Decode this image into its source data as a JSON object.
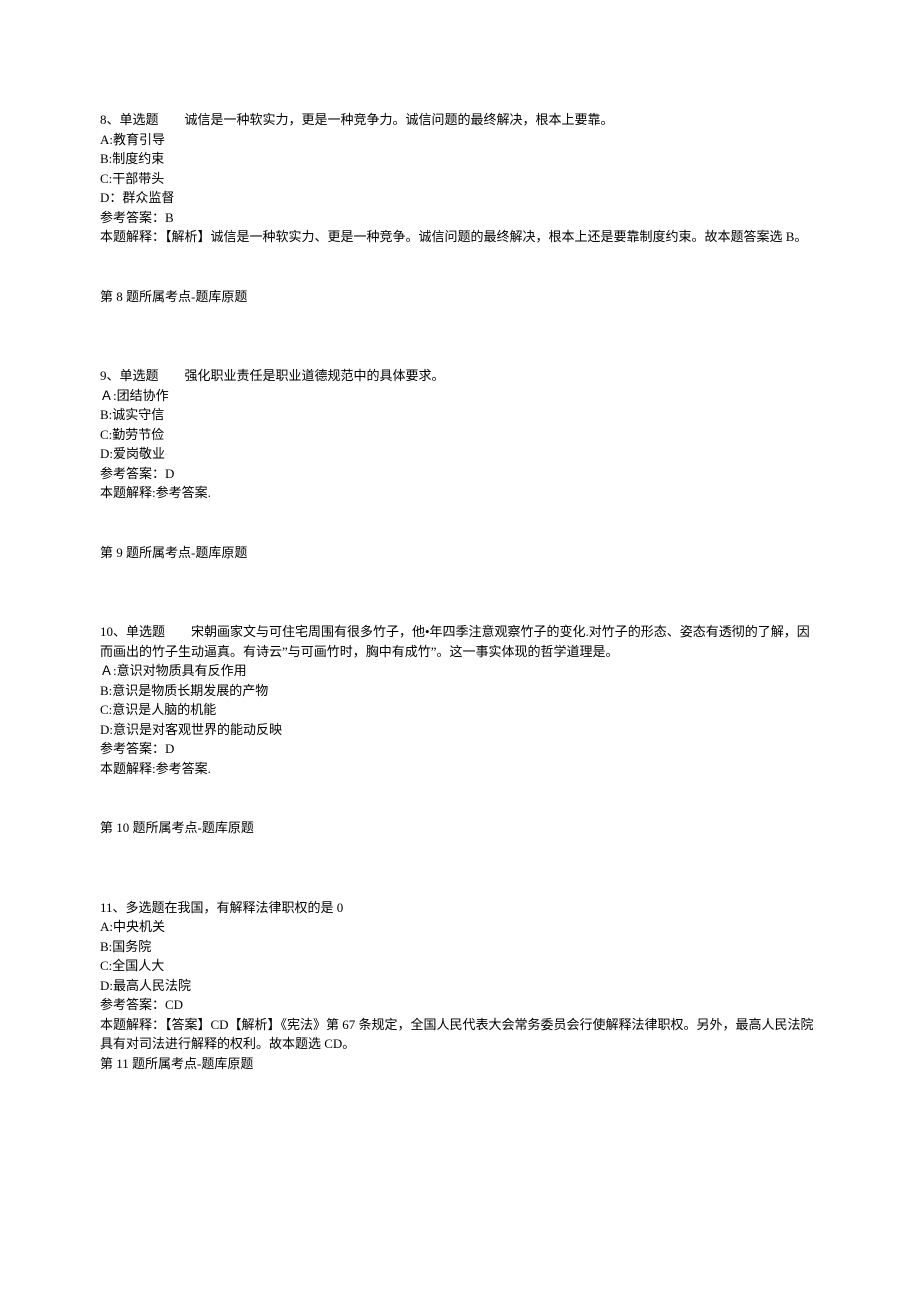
{
  "questions": [
    {
      "header": "8、单选题　　诚信是一种软实力，更是一种竞争力。诚信问题的最终解决，根本上要靠。",
      "options": [
        "A:教育引导",
        "B:制度约束",
        "C:干部带头",
        "D：群众监督"
      ],
      "answerLabel": "参考答案：B",
      "explain": "本题解释：【解析】诚信是一种软实力、更是一种竞争。诚信问题的最终解决，根本上还是要靠制度约束。故本题答案选 B。",
      "topicRef": "第 8 题所属考点-题库原题"
    },
    {
      "header": "9、单选题　　强化职业责任是职业道德规范中的具体要求。",
      "options": [
        "Ａ:团结协作",
        "B:诚实守信",
        "C:勤劳节俭",
        "D:爱岗敬业"
      ],
      "answerLabel": "参考答案：D",
      "explain": "本题解释:参考答案.",
      "topicRef": "第 9 题所属考点-题库原题"
    },
    {
      "header": "10、单选题　　宋朝画家文与可住宅周围有很多竹子，他•年四季注意观察竹子的变化.对竹子的形态、姿态有透彻的了解，因而画出的竹子生动逼真。有诗云”与可画竹时，胸中有成竹”。这一事实体现的哲学道理是。",
      "options": [
        "Ａ:意识对物质具有反作用",
        "B:意识是物质长期发展的产物",
        "C:意识是人脑的机能",
        "D:意识是对客观世界的能动反映"
      ],
      "answerLabel": "参考答案：D",
      "explain": "本题解释:参考答案.",
      "topicRef": "第 10 题所属考点-题库原题"
    },
    {
      "header": "11、多选题在我国，有解释法律职权的是 0",
      "options": [
        "A:中央机关",
        "B:国务院",
        "C:全国人大",
        "D:最高人民法院"
      ],
      "answerLabel": "参考答案：CD",
      "explain": "本题解释：【答案】CD【解析】《宪法》第 67 条规定，全国人民代表大会常务委员会行使解释法律职权。另外，最高人民法院具有对司法进行解释的权利。故本题选 CD。",
      "topicRef": "第 11 题所属考点-题库原题"
    }
  ]
}
